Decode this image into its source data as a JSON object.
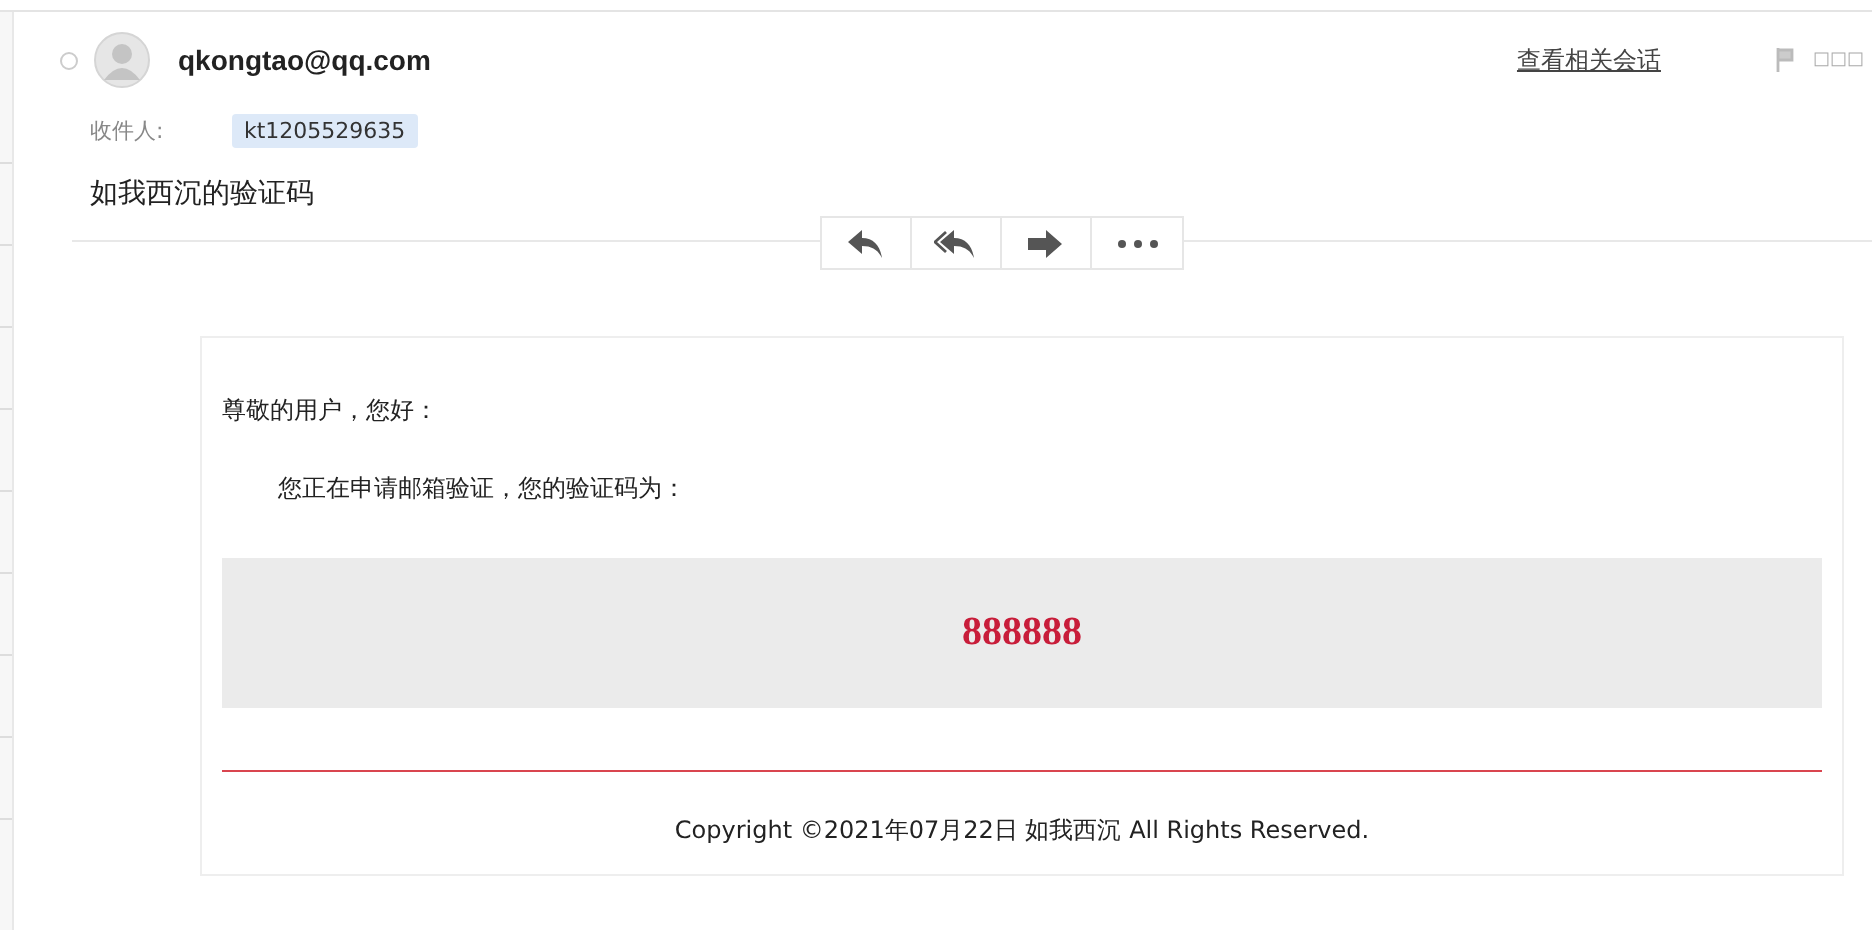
{
  "header": {
    "sender": "qkongtao@qq.com",
    "related_link": "查看相关会话",
    "flag_label": "□□□",
    "recipient_label": "收件人:",
    "recipients": [
      "kt1205529635"
    ]
  },
  "subject": "如我西沉的验证码",
  "actions": [
    {
      "kind": "reply"
    },
    {
      "kind": "reply-all"
    },
    {
      "kind": "forward"
    },
    {
      "kind": "more"
    }
  ],
  "body": {
    "greeting": "尊敬的用户，您好：",
    "message": "您正在申请邮箱验证，您的验证码为：",
    "code": "888888",
    "footer": "Copyright ©2021年07月22日 如我西沉 All Rights Reserved."
  }
}
